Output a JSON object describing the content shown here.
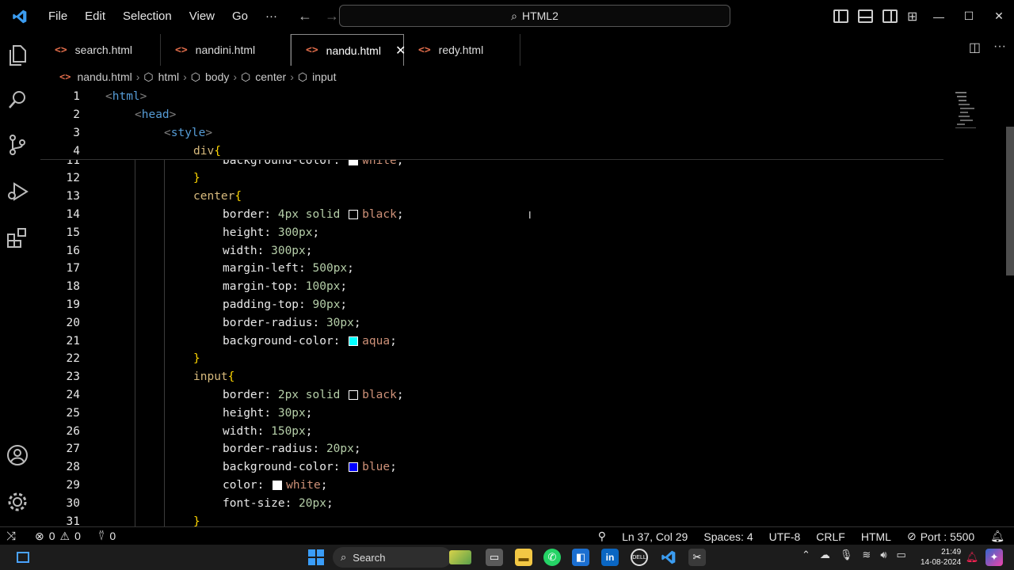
{
  "titlebar": {
    "menu": [
      "File",
      "Edit",
      "Selection",
      "View",
      "Go",
      "···"
    ],
    "command_center": "HTML2"
  },
  "tabs": [
    {
      "label": "search.html",
      "active": false
    },
    {
      "label": "nandini.html",
      "active": false
    },
    {
      "label": "nandu.html",
      "active": true
    },
    {
      "label": "redy.html",
      "active": false
    }
  ],
  "breadcrumb": [
    "nandu.html",
    "html",
    "body",
    "center",
    "input"
  ],
  "sticky_lines": [
    {
      "n": "1",
      "indent": 0,
      "text": "<html>"
    },
    {
      "n": "2",
      "indent": 1,
      "text": "<head>"
    },
    {
      "n": "3",
      "indent": 2,
      "text": "<style>"
    },
    {
      "n": "4",
      "indent": 3,
      "text": "div{"
    }
  ],
  "code_lines": [
    {
      "n": "11",
      "kind": "prop",
      "prop": "background-color",
      "swatch": "#ffffff",
      "value": "white",
      "unit": ""
    },
    {
      "n": "12",
      "kind": "close"
    },
    {
      "n": "13",
      "kind": "selector",
      "text": "center"
    },
    {
      "n": "14",
      "kind": "prop",
      "prop": "border",
      "value_prefix": "4px solid",
      "swatch": "#000000",
      "value": "black",
      "unit": ""
    },
    {
      "n": "15",
      "kind": "prop",
      "prop": "height",
      "number": "300",
      "unit": "px"
    },
    {
      "n": "16",
      "kind": "prop",
      "prop": "width",
      "number": "300",
      "unit": "px"
    },
    {
      "n": "17",
      "kind": "prop",
      "prop": "margin-left",
      "number": "500",
      "unit": "px"
    },
    {
      "n": "18",
      "kind": "prop",
      "prop": "margin-top",
      "number": "100",
      "unit": "px"
    },
    {
      "n": "19",
      "kind": "prop",
      "prop": "padding-top",
      "number": "90",
      "unit": "px"
    },
    {
      "n": "20",
      "kind": "prop",
      "prop": "border-radius",
      "number": "30",
      "unit": "px"
    },
    {
      "n": "21",
      "kind": "prop",
      "prop": "background-color",
      "swatch": "#00ffff",
      "value": "aqua",
      "unit": ""
    },
    {
      "n": "22",
      "kind": "close"
    },
    {
      "n": "23",
      "kind": "selector",
      "text": "input"
    },
    {
      "n": "24",
      "kind": "prop",
      "prop": "border",
      "value_prefix": "2px solid",
      "swatch": "#000000",
      "value": "black",
      "unit": ""
    },
    {
      "n": "25",
      "kind": "prop",
      "prop": "height",
      "number": "30",
      "unit": "px"
    },
    {
      "n": "26",
      "kind": "prop",
      "prop": "width",
      "number": "150",
      "unit": "px"
    },
    {
      "n": "27",
      "kind": "prop",
      "prop": "border-radius",
      "number": "20",
      "unit": "px"
    },
    {
      "n": "28",
      "kind": "prop",
      "prop": "background-color",
      "swatch": "#0000ff",
      "value": "blue",
      "unit": ""
    },
    {
      "n": "29",
      "kind": "prop",
      "prop": "color",
      "swatch": "#ffffff",
      "value": "white",
      "unit": ""
    },
    {
      "n": "30",
      "kind": "prop",
      "prop": "font-size",
      "number": "20",
      "unit": "px"
    },
    {
      "n": "31",
      "kind": "close"
    }
  ],
  "statusbar": {
    "errors": "0",
    "warnings": "0",
    "ports": "0",
    "position": "Ln 37, Col 29",
    "spaces": "Spaces: 4",
    "encoding": "UTF-8",
    "eol": "CRLF",
    "language": "HTML",
    "port": "Port : 5500"
  },
  "taskbar": {
    "search": "Search",
    "time": "21:49",
    "date": "14-08-2024"
  },
  "colors": {
    "tag": "#808080",
    "tagname": "#569cd6",
    "selector": "#d7ba7d",
    "brace": "#ffd700",
    "value": "#ce9178",
    "number": "#b5cea8"
  }
}
